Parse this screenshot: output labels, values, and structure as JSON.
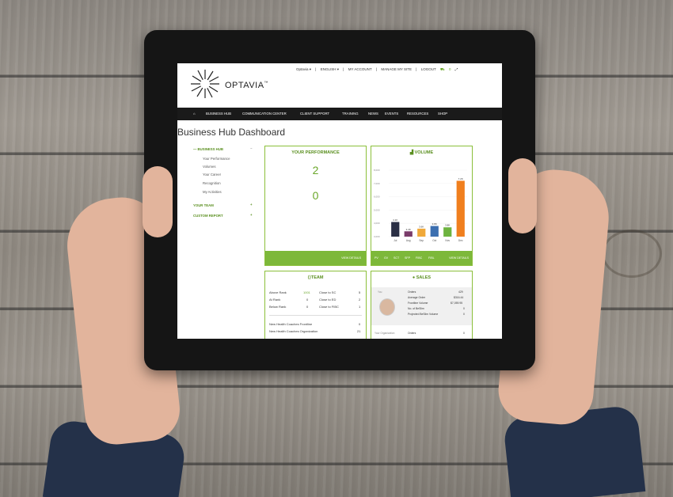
{
  "header": {
    "brand": "OPTAVIA",
    "trademark": "™",
    "top_links": [
      "Optavia ▾",
      "|",
      "ENGLISH ▾",
      "|",
      "MY ACCOUNT",
      "|",
      "MANAGE MY SITE",
      "|",
      "LOGOUT"
    ],
    "cart_count": "0"
  },
  "nav": {
    "items": [
      "BUSINESS HUB",
      "COMMUNICATION CENTER",
      "CLIENT SUPPORT",
      "TRAINING",
      "NEWS",
      "EVENTS",
      "RESOURCES",
      "SHOP"
    ]
  },
  "page_title": "Business Hub Dashboard",
  "sidebar": {
    "business_hub": "BUSINESS HUB",
    "sub_items": [
      "Your Performance",
      "Volumes",
      "Your Career",
      "Recognition",
      "My Activities"
    ],
    "your_team": "YOUR TEAM",
    "custom_report": "CUSTOM REPORT"
  },
  "performance": {
    "title": "YOUR PERFORMANCE",
    "value1": "2",
    "value2": "0",
    "view_details": "VIEW DETAILS"
  },
  "volume": {
    "title": "VOLUME",
    "view_details": "VIEW DETAILS",
    "tabs": [
      "PV",
      "GV",
      "SCT",
      "SFP",
      "FIBC",
      "FIBL"
    ]
  },
  "team": {
    "title": "TEAM",
    "rows": [
      {
        "label": "Above Rank",
        "value": "1001",
        "label2": "Close to SC",
        "value2": "5"
      },
      {
        "label": "At Rank",
        "value": "0",
        "label2": "Close to ED",
        "value2": "2"
      },
      {
        "label": "Below Rank",
        "value": "0",
        "label2": "Close to FIBC",
        "value2": "1"
      }
    ],
    "coaches": [
      {
        "label": "New Health Coaches Frontline",
        "value": "0"
      },
      {
        "label": "New Health Coaches Organization",
        "value": "21"
      }
    ]
  },
  "sales": {
    "title": "SALES",
    "you_label": "You",
    "rows": [
      {
        "label": "Orders",
        "value": "429"
      },
      {
        "label": "Average Order",
        "value": "$316.44"
      },
      {
        "label": "Frontline Volume",
        "value": "$7,059.95"
      },
      {
        "label": "No. of BeSlim",
        "value": "0"
      },
      {
        "label": "Projected BeSlim Volume",
        "value": "0"
      }
    ],
    "org_label": "Your Organization",
    "org_orders_label": "Orders",
    "org_orders_value": "0"
  },
  "chart_data": {
    "type": "bar",
    "categories": [
      "Jul",
      "Aug",
      "Sep",
      "Oct",
      "Nov",
      "Dec"
    ],
    "values": [
      4100,
      3400,
      3600,
      3800,
      3700,
      7200
    ],
    "ylim": [
      3000,
      8000
    ],
    "yticks": [
      "3,000",
      "4,000",
      "5,000",
      "6,000",
      "7,000",
      "8,000"
    ],
    "colors": [
      "#2a2f45",
      "#7a3b6a",
      "#f0a93a",
      "#3c6fb0",
      "#6db33f",
      "#f07f1e"
    ],
    "data_labels": [
      "4.1K",
      "3.4K",
      "3.6K",
      "3.8K",
      "3.8K",
      "7.2K"
    ]
  }
}
